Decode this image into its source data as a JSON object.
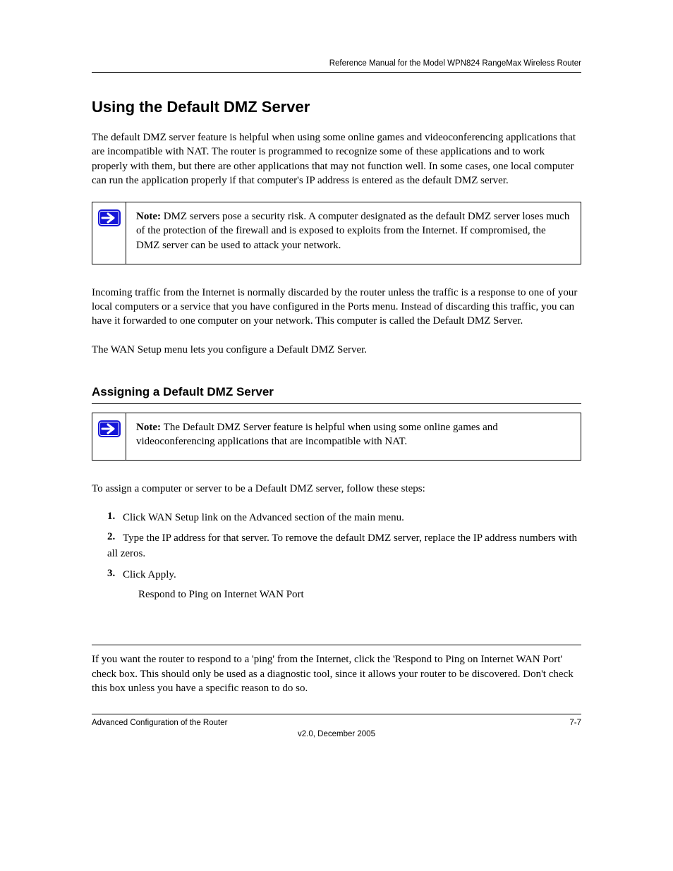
{
  "header": {
    "manual_title": "Reference Manual for the Model WPN824 RangeMax Wireless Router"
  },
  "section": {
    "title": "Using the Default DMZ Server",
    "intro": "The default DMZ server feature is helpful when using some online games and videoconferencing applications that are incompatible with NAT. The router is programmed to recognize some of these applications and to work properly with them, but there are other applications that may not function well. In some cases, one local computer can run the application properly if that computer's IP address is entered as the default DMZ server.",
    "note1": "DMZ servers pose a security risk. A computer designated as the default DMZ server loses much of the protection of the firewall and is exposed to exploits from the Internet. If compromised, the DMZ server can be used to attack your network.",
    "dmz_para": "Incoming traffic from the Internet is normally discarded by the router unless the traffic is a response to one of your local computers or a service that you have configured in the Ports menu. Instead of discarding this traffic, you can have it forwarded to one computer on your network. This computer is called the Default DMZ Server.",
    "lead": "The WAN Setup menu lets you configure a Default DMZ Server."
  },
  "subheading": "Assigning a Default DMZ Server",
  "note2": "The Default DMZ Server feature is helpful when using some online games and videoconferencing applications that are incompatible with NAT.",
  "steps": {
    "lead": "To assign a computer or server to be a Default DMZ server, follow these steps:",
    "items": [
      {
        "num": "1.",
        "text": "Click WAN Setup link on the Advanced section of the main menu."
      },
      {
        "num": "2.",
        "text": "Type the IP address for that server. To remove the default DMZ server, replace the IP address numbers with all zeros."
      },
      {
        "num": "3.",
        "text": "Click Apply."
      }
    ],
    "after": "Respond to Ping on Internet WAN Port"
  },
  "para_ping": "If you want the router to respond to a 'ping' from the Internet, click the 'Respond to Ping on Internet WAN Port' check box. This should only be used as a diagnostic tool, since it allows your router to be discovered. Don't check this box unless you have a specific reason to do so.",
  "footer": {
    "left": "Advanced Configuration of the Router",
    "right": "7-7",
    "version": "v2.0, December 2005"
  }
}
